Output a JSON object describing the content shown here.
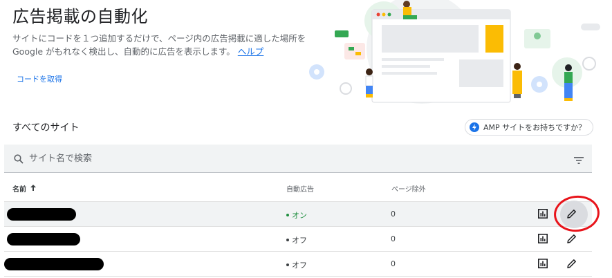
{
  "header": {
    "title": "広告掲載の自動化",
    "description": "サイトにコードを１つ追加するだけで、ページ内の広告掲載に適した場所を Google がもれなく検出し、自動的に広告を表示します。",
    "help_link": "ヘルプ",
    "get_code": "コードを取得"
  },
  "sites": {
    "title": "すべてのサイト",
    "amp_button": "AMP サイトをお持ちですか？"
  },
  "search": {
    "placeholder": "サイト名で検索"
  },
  "table": {
    "columns": {
      "name": "名前",
      "auto_ads": "自動広告",
      "page_exclusions": "ページ除外"
    },
    "rows": [
      {
        "auto_ads": "オン",
        "page_exclusions": "0"
      },
      {
        "auto_ads": "オフ",
        "page_exclusions": "0"
      },
      {
        "auto_ads": "オフ",
        "page_exclusions": "0"
      }
    ]
  },
  "colors": {
    "accent": "#1a73e8",
    "status_on": "#1e8e3e",
    "annotation_ring": "#e8141b"
  }
}
